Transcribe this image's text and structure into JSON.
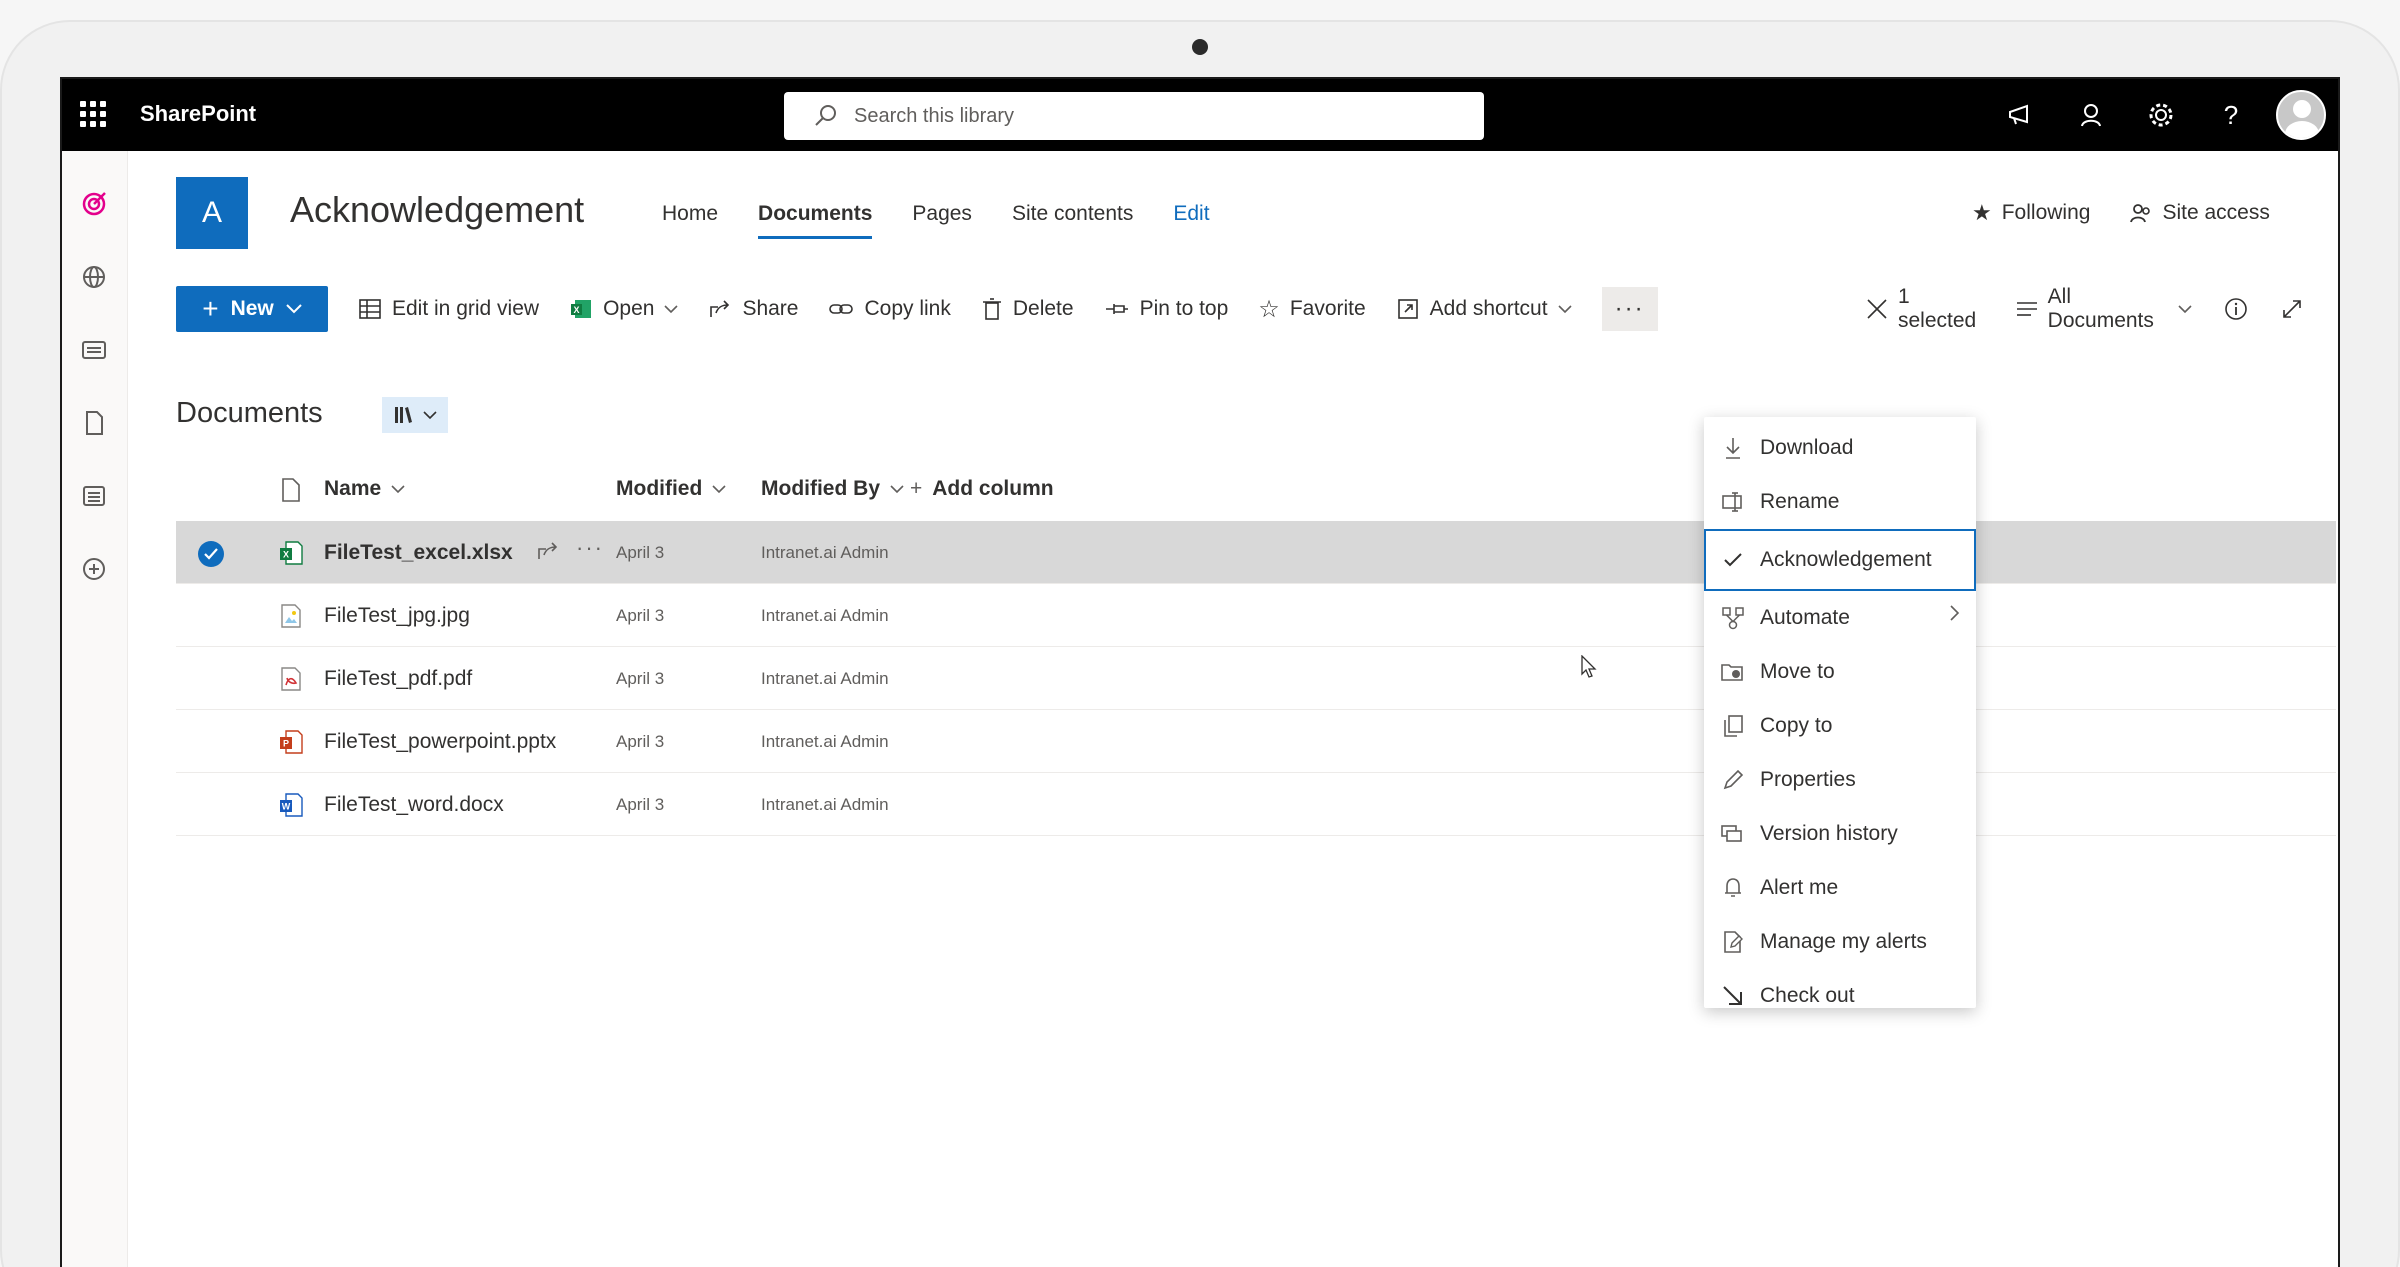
{
  "suite": {
    "app_name": "SharePoint",
    "search_placeholder": "Search this library"
  },
  "site": {
    "logo_letter": "A",
    "title": "Acknowledgement",
    "nav": [
      {
        "label": "Home",
        "active": false
      },
      {
        "label": "Documents",
        "active": true
      },
      {
        "label": "Pages",
        "active": false
      },
      {
        "label": "Site contents",
        "active": false
      },
      {
        "label": "Edit",
        "active": false
      }
    ],
    "following_label": "Following",
    "site_access_label": "Site access"
  },
  "commands": {
    "new_label": "New",
    "edit_grid_label": "Edit in grid view",
    "open_label": "Open",
    "share_label": "Share",
    "copy_link_label": "Copy link",
    "delete_label": "Delete",
    "pin_label": "Pin to top",
    "favorite_label": "Favorite",
    "add_shortcut_label": "Add shortcut",
    "more_label": "···",
    "selected_label": "1 selected",
    "view_label": "All Documents"
  },
  "library": {
    "title": "Documents",
    "columns": {
      "name": "Name",
      "modified": "Modified",
      "modified_by": "Modified By",
      "add_column": "Add column"
    },
    "files": [
      {
        "name": "FileTest_excel.xlsx",
        "modified": "April 3",
        "modified_by": "Intranet.ai Admin",
        "type": "excel",
        "selected": true
      },
      {
        "name": "FileTest_jpg.jpg",
        "modified": "April 3",
        "modified_by": "Intranet.ai Admin",
        "type": "image",
        "selected": false
      },
      {
        "name": "FileTest_pdf.pdf",
        "modified": "April 3",
        "modified_by": "Intranet.ai Admin",
        "type": "pdf",
        "selected": false
      },
      {
        "name": "FileTest_powerpoint.pptx",
        "modified": "April 3",
        "modified_by": "Intranet.ai Admin",
        "type": "powerpoint",
        "selected": false
      },
      {
        "name": "FileTest_word.docx",
        "modified": "April 3",
        "modified_by": "Intranet.ai Admin",
        "type": "word",
        "selected": false
      }
    ]
  },
  "context_menu": {
    "items": [
      {
        "label": "Download",
        "icon": "download-icon"
      },
      {
        "label": "Rename",
        "icon": "rename-icon"
      },
      {
        "label": "Acknowledgement",
        "icon": "checkmark-icon",
        "focused": true
      },
      {
        "label": "Automate",
        "icon": "automate-icon",
        "submenu": true
      },
      {
        "label": "Move to",
        "icon": "move-icon"
      },
      {
        "label": "Copy to",
        "icon": "copy-icon"
      },
      {
        "label": "Properties",
        "icon": "pencil-icon"
      },
      {
        "label": "Version history",
        "icon": "version-history-icon"
      },
      {
        "label": "Alert me",
        "icon": "bell-icon"
      },
      {
        "label": "Manage my alerts",
        "icon": "manage-alerts-icon"
      },
      {
        "label": "Check out",
        "icon": "check-out-icon"
      }
    ]
  },
  "colors": {
    "accent": "#0f6cbd",
    "suite_bar": "#000000",
    "selected_row": "#d8d8d8",
    "rail_accent": "#e3008c"
  }
}
